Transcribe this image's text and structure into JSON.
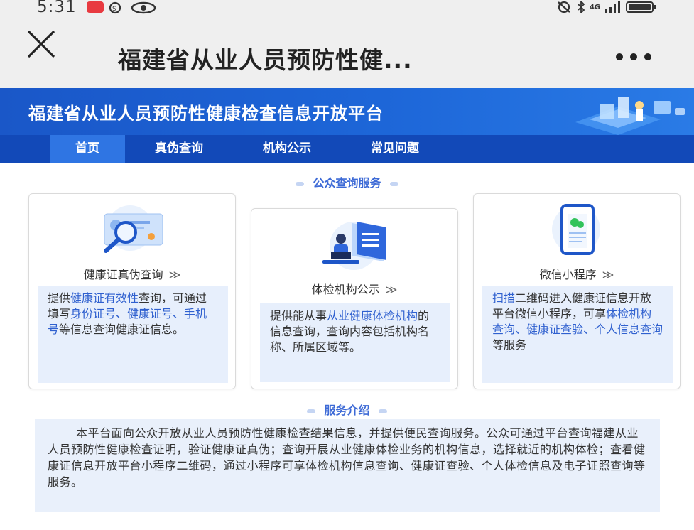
{
  "status_bar": {
    "time": "5:31",
    "network": "4G",
    "icons": [
      "notification-icon",
      "alarm-icon",
      "eye-icon",
      "mute-icon",
      "bluetooth-icon",
      "signal-icon",
      "battery-icon"
    ]
  },
  "title_bar": {
    "title": "福建省从业人员预防性健..."
  },
  "banner": {
    "title": "福建省从业人员预防性健康检查信息开放平台"
  },
  "nav": {
    "items": [
      {
        "label": "首页",
        "active": true
      },
      {
        "label": "真伪查询",
        "active": false
      },
      {
        "label": "机构公示",
        "active": false
      },
      {
        "label": "常见问题",
        "active": false
      }
    ]
  },
  "public_service": {
    "heading": "公众查询服务",
    "cards": [
      {
        "title": "健康证真伪查询",
        "chevron": "≫",
        "desc_parts": [
          {
            "text": "提供",
            "hl": false
          },
          {
            "text": "健康证有效性",
            "hl": true
          },
          {
            "text": "查询，可通过填写",
            "hl": false
          },
          {
            "text": "身份证号、健康证号、手机号",
            "hl": true
          },
          {
            "text": "等信息查询健康证信息。",
            "hl": false
          }
        ]
      },
      {
        "title": "体检机构公示",
        "chevron": "≫",
        "desc_parts": [
          {
            "text": "提供能从事",
            "hl": false
          },
          {
            "text": "从业健康体检机构",
            "hl": true
          },
          {
            "text": "的信息查询，查询内容包括机构名称、所属区域等。",
            "hl": false
          }
        ]
      },
      {
        "title": "微信小程序",
        "chevron": "≫",
        "desc_parts": [
          {
            "text": "扫描",
            "hl": true
          },
          {
            "text": "二维码进入健康证信息开放平台微信小程序，可享",
            "hl": false
          },
          {
            "text": "体检机构查询、健康证查验、个人信息查询",
            "hl": true
          },
          {
            "text": "等服务",
            "hl": false
          }
        ]
      }
    ]
  },
  "service_intro": {
    "heading": "服务介绍",
    "text": "本平台面向公众开放从业人员预防性健康检查结果信息，并提供便民查询服务。公众可通过平台查询福建从业人员预防性健康检查证明，验证健康证真伪；查询开展从业健康体检业务的机构信息，选择就近的机构体检；查看健康证信息开放平台小程序二维码，通过小程序可享体检机构信息查询、健康证查验、个人体检信息及电子证照查询等服务。"
  },
  "colors": {
    "banner": "#1d66d8",
    "nav": "#1249b8",
    "nav_active": "#2f75e3",
    "highlight": "#2f60cf",
    "desc_bg": "#e7effc"
  }
}
